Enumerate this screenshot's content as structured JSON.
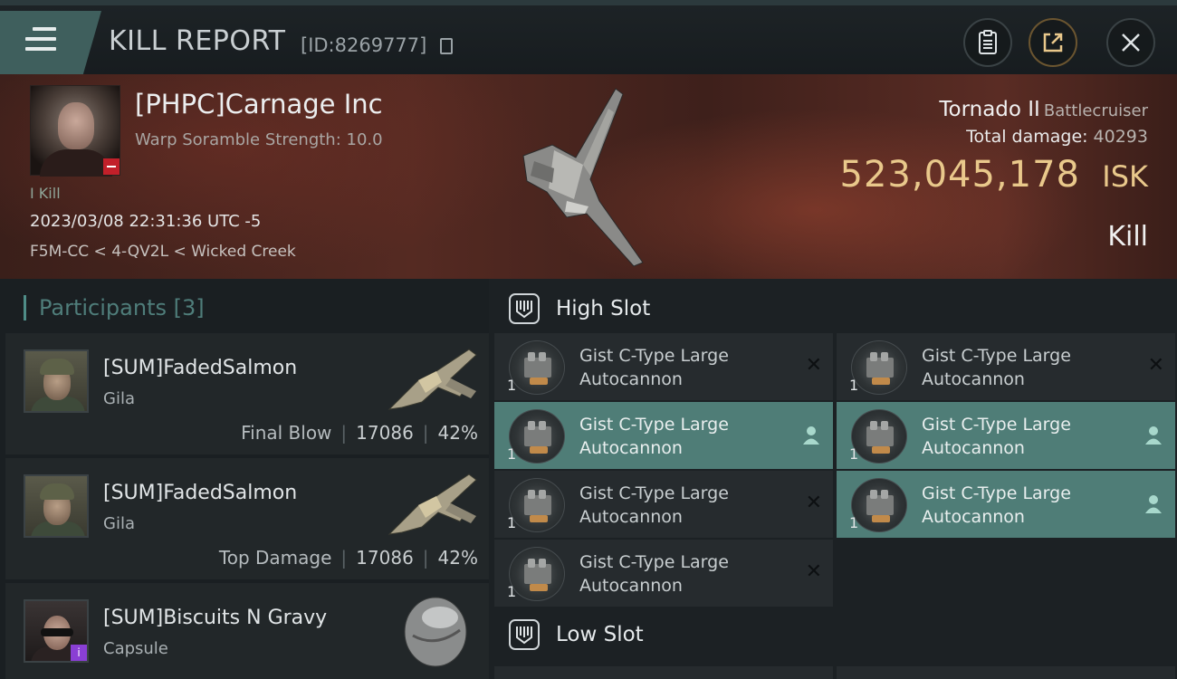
{
  "header": {
    "title": "KILL REPORT",
    "report_id": "[ID:8269777]"
  },
  "victim": {
    "name": "[PHPC]Carnage Inc",
    "warp_scramble": "Warp Soramble Strength: 10.0",
    "kill_count": "I Kill",
    "date": "2023/03/08 22:31:36 UTC -5",
    "location": "F5M-CC < 4-QV2L < Wicked Creek"
  },
  "ship": {
    "name": "Tornado II",
    "class": "Battlecruiser",
    "total_damage_label": "Total damage:",
    "total_damage": "40293",
    "isk_value": "523,045,178",
    "isk_unit": "ISK",
    "result": "Kill"
  },
  "participants": {
    "header": "Participants [3]",
    "items": [
      {
        "name": "[SUM]FadedSalmon",
        "ship": "Gila",
        "label": "Final Blow",
        "damage": "17086",
        "percent": "42%"
      },
      {
        "name": "[SUM]FadedSalmon",
        "ship": "Gila",
        "label": "Top Damage",
        "damage": "17086",
        "percent": "42%"
      },
      {
        "name": "[SUM]Biscuits N Gravy",
        "ship": "Capsule"
      }
    ]
  },
  "fitting": {
    "high_slot": {
      "label": "High Slot",
      "modules": [
        {
          "qty": "1",
          "line1": "Gist C-Type Large",
          "line2": "Autocannon",
          "state": "destroyed"
        },
        {
          "qty": "1",
          "line1": "Gist C-Type Large",
          "line2": "Autocannon",
          "state": "destroyed"
        },
        {
          "qty": "1",
          "line1": "Gist C-Type Large",
          "line2": "Autocannon",
          "state": "dropped"
        },
        {
          "qty": "1",
          "line1": "Gist C-Type Large",
          "line2": "Autocannon",
          "state": "dropped"
        },
        {
          "qty": "1",
          "line1": "Gist C-Type Large",
          "line2": "Autocannon",
          "state": "destroyed"
        },
        {
          "qty": "1",
          "line1": "Gist C-Type Large",
          "line2": "Autocannon",
          "state": "dropped"
        },
        {
          "qty": "1",
          "line1": "Gist C-Type Large",
          "line2": "Autocannon",
          "state": "destroyed"
        }
      ]
    },
    "low_slot": {
      "label": "Low Slot"
    }
  },
  "icons": {
    "menu": "hamburger-menu-icon",
    "copy": "copy-icon",
    "clipboard": "clipboard-icon",
    "share": "share-icon",
    "close": "close-icon",
    "slot": "slot-shield-icon",
    "destroyed": "destroyed-x-icon",
    "dropped": "pilot-icon"
  },
  "colors": {
    "accent": "#4f7d77",
    "isk": "#e9c88b",
    "banner": "#552a22",
    "badge_red": "#c2202a",
    "badge_purple": "#8a3fd4"
  }
}
